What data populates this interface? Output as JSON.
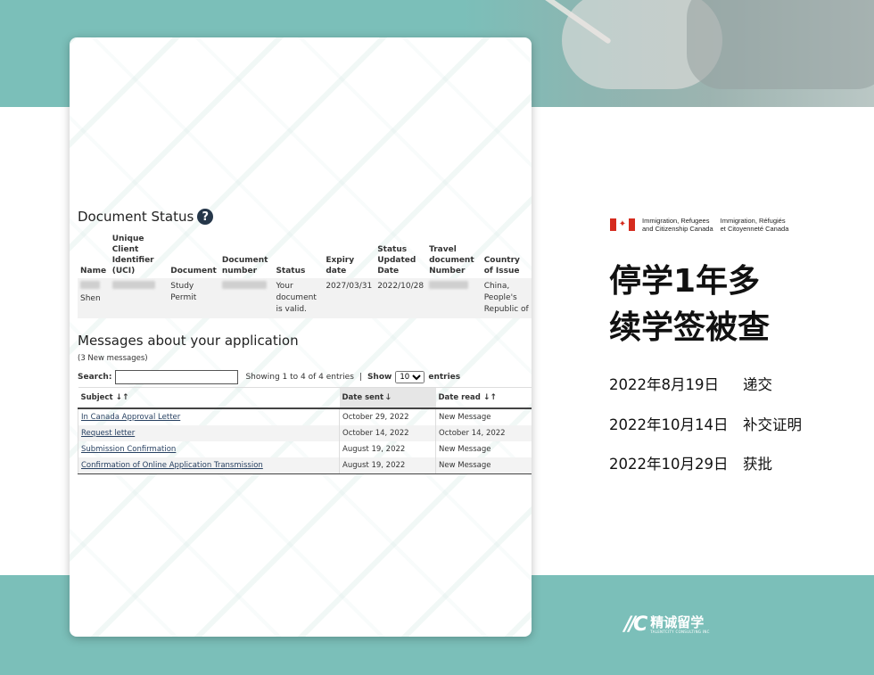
{
  "document_status": {
    "title": "Document Status",
    "help_icon": "?",
    "headers": [
      "Name",
      "Unique Client Identifier (UCI)",
      "Document",
      "Document number",
      "Status",
      "Expiry date",
      "Status Updated Date",
      "Travel document Number",
      "Country of Issue"
    ],
    "row": {
      "name": "Shen",
      "document": "Study Permit",
      "status": "Your document is valid.",
      "expiry_date": "2027/03/31",
      "updated_date": "2022/10/28",
      "country": "China, People's Republic of"
    }
  },
  "messages": {
    "title": "Messages about your application",
    "new_count": "(3 New messages)",
    "search_label": "Search:",
    "showing_text": "Showing 1 to 4 of 4 entries",
    "show_label": "Show",
    "entries_value": "10",
    "entries_label": "entries",
    "headers": {
      "subject": "Subject",
      "date_sent": "Date sent",
      "date_read": "Date read"
    },
    "rows": [
      {
        "subject": "In Canada Approval Letter",
        "date_sent": "October 29, 2022",
        "date_read": "New Message"
      },
      {
        "subject": "Request letter",
        "date_sent": "October 14, 2022",
        "date_read": "October 14, 2022"
      },
      {
        "subject": "Submission Confirmation",
        "date_sent": "August 19, 2022",
        "date_read": "New Message"
      },
      {
        "subject": "Confirmation of Online Application Transmission",
        "date_sent": "August 19, 2022",
        "date_read": "New Message"
      }
    ]
  },
  "ircc": {
    "en_line1": "Immigration, Refugees",
    "en_line2": "and Citizenship Canada",
    "fr_line1": "Immigration, Réfugiés",
    "fr_line2": "et Citoyenneté Canada"
  },
  "headline": {
    "line1": "停学1年多",
    "line2": "续学签被查"
  },
  "timeline": [
    {
      "date": "2022年8月19日",
      "event": "递交"
    },
    {
      "date": "2022年10月14日",
      "event": "补交证明"
    },
    {
      "date": "2022年10月29日",
      "event": "获批"
    }
  ],
  "logo": {
    "cn": "精诚留学",
    "en": "TALENTCITY CONSULTING INC"
  },
  "colors": {
    "teal": "#7bbfb9",
    "navy": "#26374a",
    "link": "#284162",
    "flag_red": "#d52b1e"
  }
}
